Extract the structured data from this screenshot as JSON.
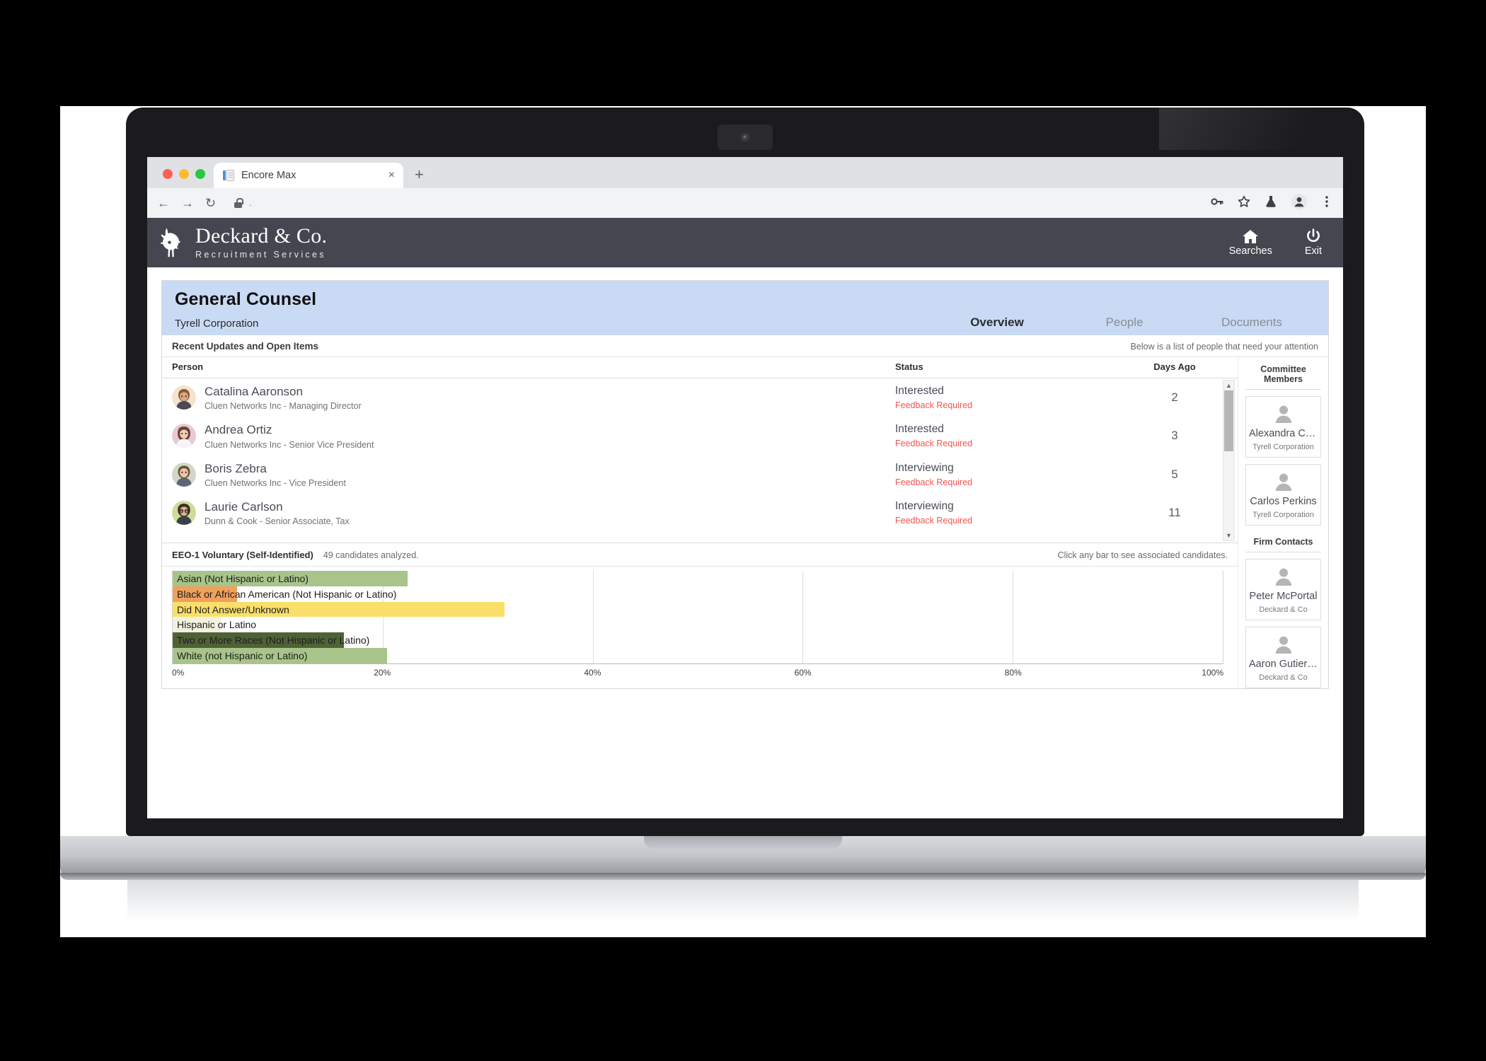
{
  "browser": {
    "tab_title": "Encore Max",
    "tab_close": "×",
    "new_tab": "+",
    "back": "←",
    "forward": "→",
    "reload": "↻",
    "address_value": ".",
    "toolbar_icons": [
      "key-icon",
      "star-icon",
      "flask-icon",
      "profile-icon",
      "kebab-menu-icon"
    ]
  },
  "app_header": {
    "brand_name": "Deckard & Co.",
    "brand_sub": "Recruitment Services",
    "nav": [
      {
        "label": "Searches",
        "icon": "home-icon"
      },
      {
        "label": "Exit",
        "icon": "power-icon"
      }
    ]
  },
  "page": {
    "title": "General Counsel",
    "subtitle": "Tyrell Corporation",
    "tabs": [
      {
        "label": "Overview",
        "active": true
      },
      {
        "label": "People",
        "active": false
      },
      {
        "label": "Documents",
        "active": false
      }
    ]
  },
  "updates": {
    "section_title": "Recent Updates and Open Items",
    "section_hint": "Below is a list of people that need your attention",
    "columns": {
      "person": "Person",
      "status": "Status",
      "days": "Days Ago"
    },
    "rows": [
      {
        "name": "Catalina Aaronson",
        "meta": "Cluen Networks Inc - Managing Director",
        "status": "Interested",
        "flag": "Feedback Required",
        "days": "2"
      },
      {
        "name": "Andrea Ortiz",
        "meta": "Cluen Networks Inc - Senior Vice President",
        "status": "Interested",
        "flag": "Feedback Required",
        "days": "3"
      },
      {
        "name": "Boris Zebra",
        "meta": "Cluen Networks Inc - Vice President",
        "status": "Interviewing",
        "flag": "Feedback Required",
        "days": "5"
      },
      {
        "name": "Laurie Carlson",
        "meta": "Dunn & Cook - Senior Associate, Tax",
        "status": "Interviewing",
        "flag": "Feedback Required",
        "days": "11"
      }
    ]
  },
  "eeo": {
    "title": "EEO-1 Voluntary (Self-Identified)",
    "count_text": "49 candidates analyzed.",
    "hint": "Click any bar to see associated candidates."
  },
  "chart_data": {
    "type": "bar",
    "orientation": "horizontal",
    "title": "EEO-1 Voluntary (Self-Identified)",
    "xlabel": "",
    "ylabel": "",
    "xlim": [
      0,
      100
    ],
    "grid": true,
    "legend": "none",
    "tick_labels": [
      "0%",
      "20%",
      "40%",
      "60%",
      "80%",
      "100%"
    ],
    "ticks": [
      0,
      20,
      40,
      60,
      80,
      100
    ],
    "categories": [
      "Asian (Not Hispanic or Latino)",
      "Black or African American (Not Hispanic or Latino)",
      "Did Not Answer/Unknown",
      "Hispanic or Latino",
      "Two or More Races (Not Hispanic or Latino)",
      "White (not Hispanic or Latino)"
    ],
    "values": [
      22.4,
      6.1,
      31.6,
      4.6,
      16.3,
      20.4
    ],
    "colors": [
      "#a8c48a",
      "#f0a15c",
      "#fbdf6b",
      "#f2f2e0",
      "#4f6236",
      "#a8c48a"
    ]
  },
  "sidebar": {
    "committee_title": "Committee Members",
    "firm_title": "Firm Contacts",
    "committee": [
      {
        "name": "Alexandra Ca...",
        "org": "Tyrell Corporation",
        "avatar": "person-icon"
      },
      {
        "name": "Carlos Perkins",
        "org": "Tyrell Corporation",
        "avatar": "person-icon"
      }
    ],
    "firm": [
      {
        "name": "Peter McPortal",
        "org": "Deckard & Co",
        "avatar": "person-icon"
      },
      {
        "name": "Aaron Gutierrez",
        "org": "Deckard & Co",
        "avatar": "person-icon"
      }
    ]
  },
  "scrollbar": {
    "up": "▲",
    "down": "▼"
  }
}
